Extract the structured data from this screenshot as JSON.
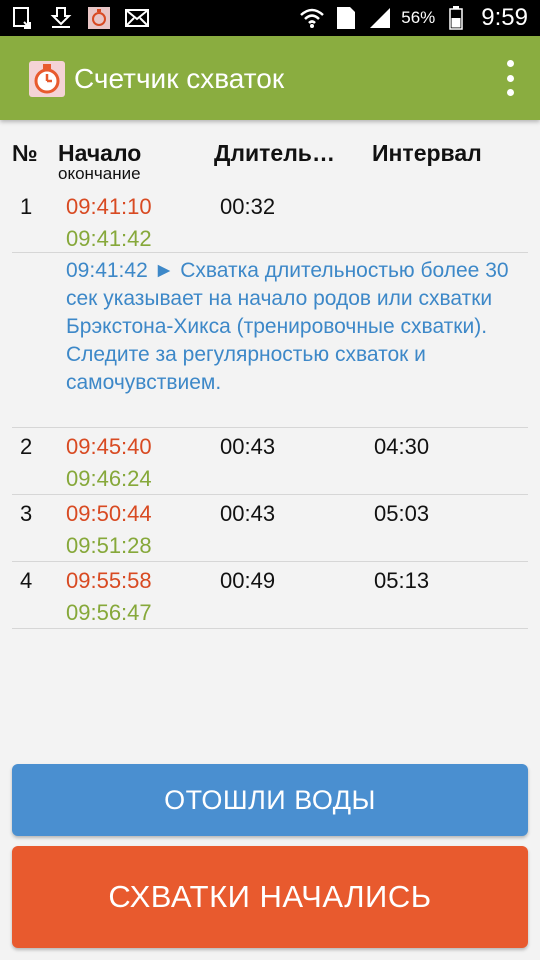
{
  "status_bar": {
    "battery": "56%",
    "time": "9:59",
    "sim_slot": "1",
    "icons": [
      "screenshot-icon",
      "download-icon",
      "app-thumbnail-icon",
      "mail-icon",
      "wifi-icon",
      "sim-icon",
      "signal-icon",
      "battery-icon"
    ]
  },
  "app_bar": {
    "title": "Счетчик схваток",
    "logo_icon": "stopwatch-logo-icon",
    "menu_icon": "overflow-menu-icon"
  },
  "table": {
    "headers": {
      "number": "№",
      "start": "Начало",
      "start_sub": "окончание",
      "duration": "Длитель…",
      "interval": "Интервал"
    },
    "rows": [
      {
        "number": "1",
        "start": "09:41:10",
        "end": "09:41:42",
        "duration": "00:32",
        "interval": ""
      },
      {
        "number": "2",
        "start": "09:45:40",
        "end": "09:46:24",
        "duration": "00:43",
        "interval": "04:30"
      },
      {
        "number": "3",
        "start": "09:50:44",
        "end": "09:51:28",
        "duration": "00:43",
        "interval": "05:03"
      },
      {
        "number": "4",
        "start": "09:55:58",
        "end": "09:56:47",
        "duration": "00:49",
        "interval": "05:13"
      }
    ],
    "note": "09:41:42 ► Схватка длительностью более 30 сек указывает на начало родов или схватки Брэкстона-Хикса (тренировочные схватки). Следите за регулярностью схваток и самочувствием."
  },
  "buttons": {
    "water": "ОТОШЛИ ВОДЫ",
    "contractions": "СХВАТКИ НАЧАЛИСЬ"
  },
  "colors": {
    "app_bar": "#8aad40",
    "start_time": "#d84a22",
    "end_time": "#86a83a",
    "note_text": "#3d88c8",
    "water_button": "#4a8fd0",
    "contractions_button": "#e85a2e"
  }
}
